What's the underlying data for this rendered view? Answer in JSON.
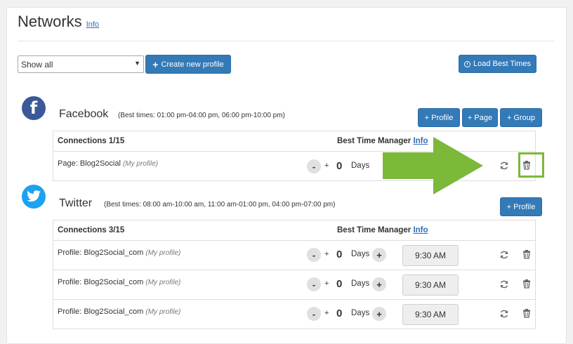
{
  "header": {
    "title": "Networks",
    "info": "Info"
  },
  "toolbar": {
    "filter_value": "Show all",
    "create_label": "Create new profile",
    "load_label": "Load Best Times"
  },
  "facebook": {
    "name": "Facebook",
    "best_times": "(Best times: 01:00 pm-04:00 pm, 06:00 pm-10:00 pm)",
    "buttons": {
      "profile": "+ Profile",
      "page": "+ Page",
      "group": "+ Group"
    },
    "connections": "Connections 1/15",
    "best_time_manager": "Best Time Manager",
    "info": "Info",
    "rows": [
      {
        "type": "Page:",
        "name": "Blog2Social",
        "note": "(My profile)",
        "minus": "-",
        "plus": "+",
        "days": "0",
        "days_label": "Days"
      }
    ]
  },
  "twitter": {
    "name": "Twitter",
    "best_times": "(Best times: 08:00 am-10:00 am, 11:00 am-01:00 pm, 04:00 pm-07:00 pm)",
    "buttons": {
      "profile": "+ Profile"
    },
    "connections": "Connections 3/15",
    "best_time_manager": "Best Time Manager",
    "info": "Info",
    "rows": [
      {
        "type": "Profile:",
        "name": "Blog2Social_com",
        "note": "(My profile)",
        "minus": "-",
        "plus": "+",
        "days": "0",
        "days_label": "Days",
        "plus_circle": "+",
        "time": "9:30 AM"
      },
      {
        "type": "Profile:",
        "name": "Blog2Social_com",
        "note": "(My profile)",
        "minus": "-",
        "plus": "+",
        "days": "0",
        "days_label": "Days",
        "plus_circle": "+",
        "time": "9:30 AM"
      },
      {
        "type": "Profile:",
        "name": "Blog2Social_com",
        "note": "(My profile)",
        "minus": "-",
        "plus": "+",
        "days": "0",
        "days_label": "Days",
        "plus_circle": "+",
        "time": "9:30 AM"
      }
    ]
  },
  "icons": {
    "facebook_logo": "facebook-logo-icon",
    "twitter_logo": "twitter-logo-icon",
    "refresh": "refresh-icon",
    "delete": "trash-icon",
    "clock": "clock-icon",
    "arrow": "green-arrow-icon"
  },
  "colors": {
    "primary": "#337ab7",
    "facebook": "#3b5998",
    "twitter": "#1da1f2",
    "highlight": "#7cb83a"
  }
}
